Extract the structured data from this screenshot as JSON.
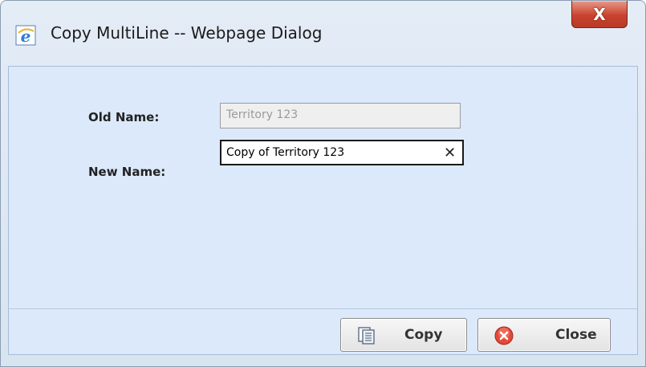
{
  "window": {
    "title": "Copy MultiLine -- Webpage Dialog",
    "close_glyph": "X",
    "icon": "ie-icon"
  },
  "form": {
    "old_name_label": "Old Name:",
    "old_name_value": "Territory 123",
    "new_name_label": "New Name:",
    "new_name_value": "Copy of Territory 123",
    "clear_glyph": "✕"
  },
  "buttons": {
    "copy_label": "Copy",
    "copy_icon": "copy-icon",
    "close_label": "Close",
    "close_icon": "close-circle-icon"
  },
  "colors": {
    "content_bg": "#dbe9fb",
    "close_red": "#c9432f"
  }
}
